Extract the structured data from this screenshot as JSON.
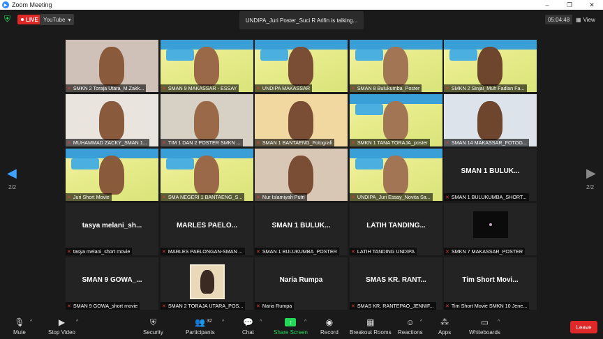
{
  "window": {
    "title": "Zoom Meeting"
  },
  "topbar": {
    "live_label": "LIVE",
    "stream_target": "YouTube",
    "talking_banner": "UNDIPA_Juri Poster_Suci R Arifin is talking...",
    "timer": "05:04:48",
    "view_label": "View"
  },
  "pager": {
    "left_page": "2/2",
    "right_page": "2/2"
  },
  "tiles": [
    {
      "label": "SMKN 2 Toraja Utara_M.Zakk...",
      "has_video": true,
      "bg": "#cfc1b8",
      "name": ""
    },
    {
      "label": "SMAN 9 MAKASSAR - ESSAY",
      "has_video": true,
      "bg": "poster",
      "name": ""
    },
    {
      "label": "UNDIPA MAKASSAR",
      "has_video": true,
      "bg": "poster",
      "name": ""
    },
    {
      "label": "SMAN 8 Bulukumba_Poster",
      "has_video": true,
      "bg": "poster",
      "name": ""
    },
    {
      "label": "SMKN 2 Sinjai_Muh Fadlan Fa...",
      "has_video": true,
      "bg": "poster",
      "name": ""
    },
    {
      "label": "MUHAMMAD ZACKY_SMAN 1...",
      "has_video": true,
      "bg": "#e9e4de",
      "name": ""
    },
    {
      "label": "TIM 1 DAN 2 POSTER SMKN ...",
      "has_video": true,
      "bg": "#d7d0c4",
      "name": ""
    },
    {
      "label": "SMAN 1 BANTAENG_Fotografi",
      "has_video": true,
      "bg": "#f1d7a0",
      "name": ""
    },
    {
      "label": "SMKN 1 TANA TORAJA_poster",
      "has_video": true,
      "bg": "poster",
      "name": ""
    },
    {
      "label": "SMAN 14 MAKASSAR_FOTOG...",
      "has_video": true,
      "bg": "#dde3ea",
      "name": ""
    },
    {
      "label": "Juri Short Movie",
      "has_video": true,
      "bg": "poster",
      "name": ""
    },
    {
      "label": "SMA NEGERI 1 BANTAENG_S...",
      "has_video": true,
      "bg": "poster",
      "name": ""
    },
    {
      "label": "Nur Islamiyah Putri",
      "has_video": true,
      "bg": "#d9c7b5",
      "name": ""
    },
    {
      "label": "UNDIPA_Juri Essay_Novita Sa...",
      "has_video": true,
      "bg": "poster",
      "name": ""
    },
    {
      "label": "SMAN 1 BULUKUMBA_SHORT...",
      "has_video": false,
      "bg": "",
      "name": "SMAN 1 BULUK..."
    },
    {
      "label": "tasya melani_short movie",
      "has_video": false,
      "bg": "",
      "name": "tasya melani_sh..."
    },
    {
      "label": "MARLES PAELONGAN-SMAN ...",
      "has_video": false,
      "bg": "",
      "name": "MARLES PAELO..."
    },
    {
      "label": "SMAN 1 BULUKUMBA_POSTER",
      "has_video": false,
      "bg": "",
      "name": "SMAN 1 BULUK..."
    },
    {
      "label": "LATIH TANDING UNDIPA",
      "has_video": false,
      "bg": "",
      "name": "LATIH TANDING..."
    },
    {
      "label": "SMKN 7 MAKASSAR_POSTER",
      "has_video": false,
      "bg": "",
      "name": ""
    },
    {
      "label": "SMAN 9 GOWA_short movie",
      "has_video": false,
      "bg": "",
      "name": "SMAN 9 GOWA_..."
    },
    {
      "label": "SMAN 2 TORAJA UTARA_POS...",
      "has_video": false,
      "bg": "",
      "name": ""
    },
    {
      "label": "Naria Rumpa",
      "has_video": false,
      "bg": "",
      "name": "Naria Rumpa"
    },
    {
      "label": "SMAS KR. RANTEPAO_JENNIF...",
      "has_video": false,
      "bg": "",
      "name": "SMAS KR. RANT..."
    },
    {
      "label": "Tim Short Movie SMKN 10 Jene...",
      "has_video": false,
      "bg": "",
      "name": "Tim Short Movi..."
    }
  ],
  "toolbar": {
    "mute": "Mute",
    "stop_video": "Stop Video",
    "security": "Security",
    "participants": "Participants",
    "participants_count": "32",
    "chat": "Chat",
    "share_screen": "Share Screen",
    "record": "Record",
    "breakout_rooms": "Breakout Rooms",
    "reactions": "Reactions",
    "apps": "Apps",
    "whiteboards": "Whiteboards",
    "leave": "Leave"
  },
  "colors": {
    "accent": "#2d8cff",
    "live": "#e02828",
    "share": "#23d959",
    "muted": "#e23b3b"
  }
}
